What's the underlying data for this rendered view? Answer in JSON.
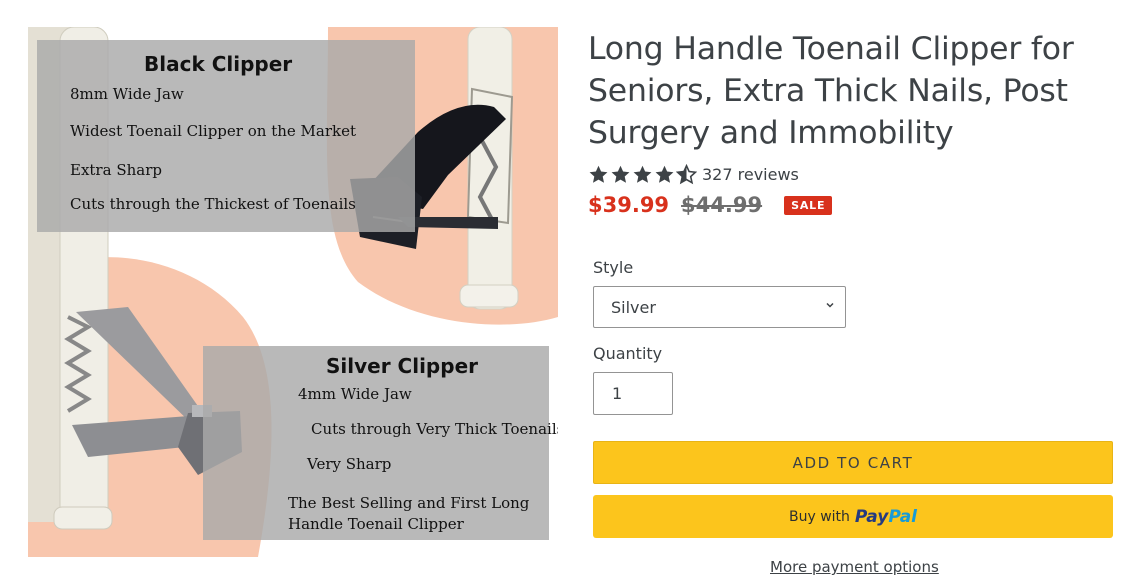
{
  "product_image": {
    "black_clipper": {
      "title": "Black Clipper",
      "features": [
        "8mm Wide Jaw",
        "Widest Toenail Clipper on the Market",
        "Extra Sharp",
        "Cuts through the Thickest of Toenails"
      ]
    },
    "silver_clipper": {
      "title": "Silver Clipper",
      "features": [
        "4mm Wide Jaw",
        "Cuts through Very Thick Toenails",
        "Very Sharp",
        "The Best Selling and First Long",
        "Handle Toenail Clipper"
      ]
    }
  },
  "product": {
    "title": "Long Handle Toenail Clipper for Seniors, Extra Thick Nails, Post Surgery and Immobility",
    "rating": 4.5,
    "review_count": "327 reviews",
    "sale_price": "$39.99",
    "regular_price": "$44.99",
    "badge": "SALE"
  },
  "form": {
    "style_label": "Style",
    "style_value": "Silver",
    "quantity_label": "Quantity",
    "quantity_value": "1",
    "add_to_cart": "ADD TO CART",
    "paypal_prefix": "Buy with",
    "paypal_brand_1": "Pay",
    "paypal_brand_2": "Pal",
    "more_options": "More payment options"
  },
  "colors": {
    "sale_red": "#d8311c",
    "button_yellow": "#fcc51c",
    "paypal_dark_blue": "#253b80",
    "paypal_light_blue": "#179bd7",
    "peach_background": "#f8c6ad",
    "text": "#3d4246"
  },
  "icons": [
    "star-icon",
    "half-star-icon",
    "chevron-down-icon",
    "black-clipper-image",
    "silver-clipper-image"
  ]
}
